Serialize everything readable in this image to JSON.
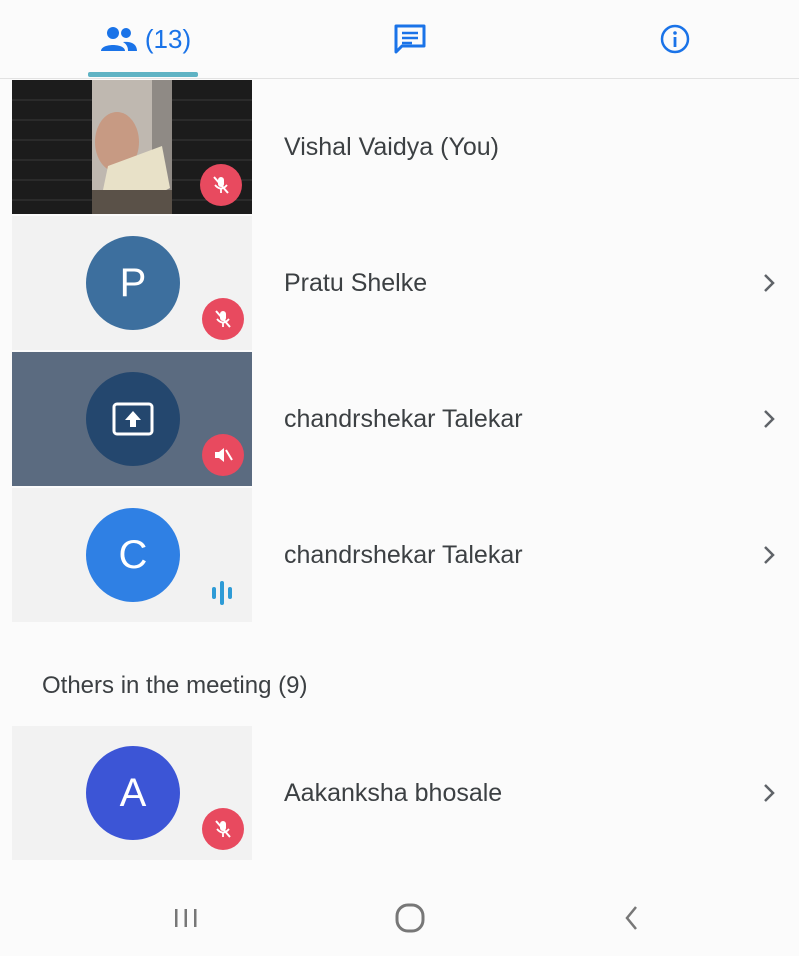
{
  "tabs": {
    "people_count": "(13)",
    "people_icon": "people-icon",
    "chat_icon": "chat-icon",
    "info_icon": "info-icon",
    "accent": "#1a73e8"
  },
  "participants": [
    {
      "name": "Vishal Vaidya (You)",
      "tile": "camera-video",
      "mic": "muted"
    },
    {
      "name": "Pratu Shelke",
      "initial": "P",
      "avatar_color": "#3d6f9e",
      "mic": "muted"
    },
    {
      "name": "chandrshekar Talekar",
      "tile": "screen-share",
      "mic": "muted"
    },
    {
      "name": "chandrshekar Talekar",
      "initial": "C",
      "avatar_color": "#2f80e4",
      "mic": "speaking"
    }
  ],
  "others": {
    "title": "Others in the meeting (9)",
    "items": [
      {
        "name": "Aakanksha bhosale",
        "initial": "A",
        "avatar_color": "#3c55d6",
        "mic": "muted"
      }
    ]
  },
  "colors": {
    "muted_badge": "#e84a5f",
    "speaking": "#2e9bd6"
  },
  "navbar": {
    "icons": [
      "recents-icon",
      "home-icon",
      "back-icon"
    ]
  }
}
